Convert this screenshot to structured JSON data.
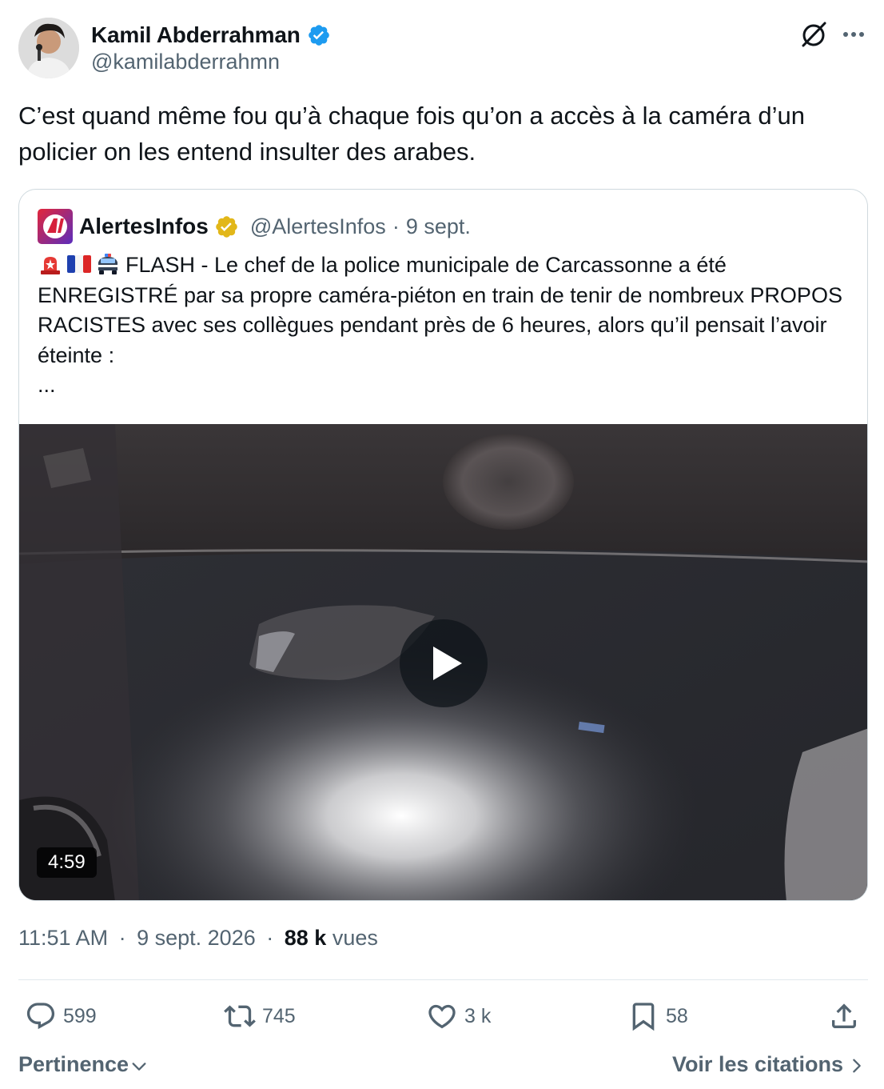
{
  "author": {
    "name": "Kamil Abderrahman",
    "handle": "@kamilabderrahmn",
    "verified_color": "#1d9bf0"
  },
  "tweet": {
    "text": "C’est quand même fou qu’à chaque fois qu’on a accès à la caméra d’un policier on les entend insulter des arabes."
  },
  "quoted_tweet": {
    "name": "AlertesInfos",
    "handle": "@AlertesInfos",
    "separator": "·",
    "date": "9 sept.",
    "badge_color": "#e2b719",
    "emojis": [
      "police-light-emoji",
      "france-flag-emoji",
      "police-car-emoji"
    ],
    "text": "FLASH - Le chef de la police municipale de Carcassonne a été ENREGISTRÉ par sa propre caméra-piéton en train de tenir de nombreux PROPOS RACISTES avec ses collègues pendant près de 6 heures, alors qu’il pensait l’avoir éteinte :",
    "ellipsis": "...",
    "video": {
      "duration": "4:59"
    }
  },
  "meta": {
    "time": "11:51 AM",
    "separator": "·",
    "date": "9 sept. 2026",
    "views_count": "88 k",
    "views_label": "vues"
  },
  "actions": {
    "replies": "599",
    "reposts": "745",
    "likes": "3 k",
    "bookmarks": "58"
  },
  "footer": {
    "sort_label": "Pertinence",
    "quotes_label": "Voir les citations"
  },
  "icons": {
    "grok": "grok-icon",
    "more": "more-icon",
    "reply": "reply-icon",
    "repost": "repost-icon",
    "like": "heart-icon",
    "bookmark": "bookmark-icon",
    "share": "share-icon"
  }
}
